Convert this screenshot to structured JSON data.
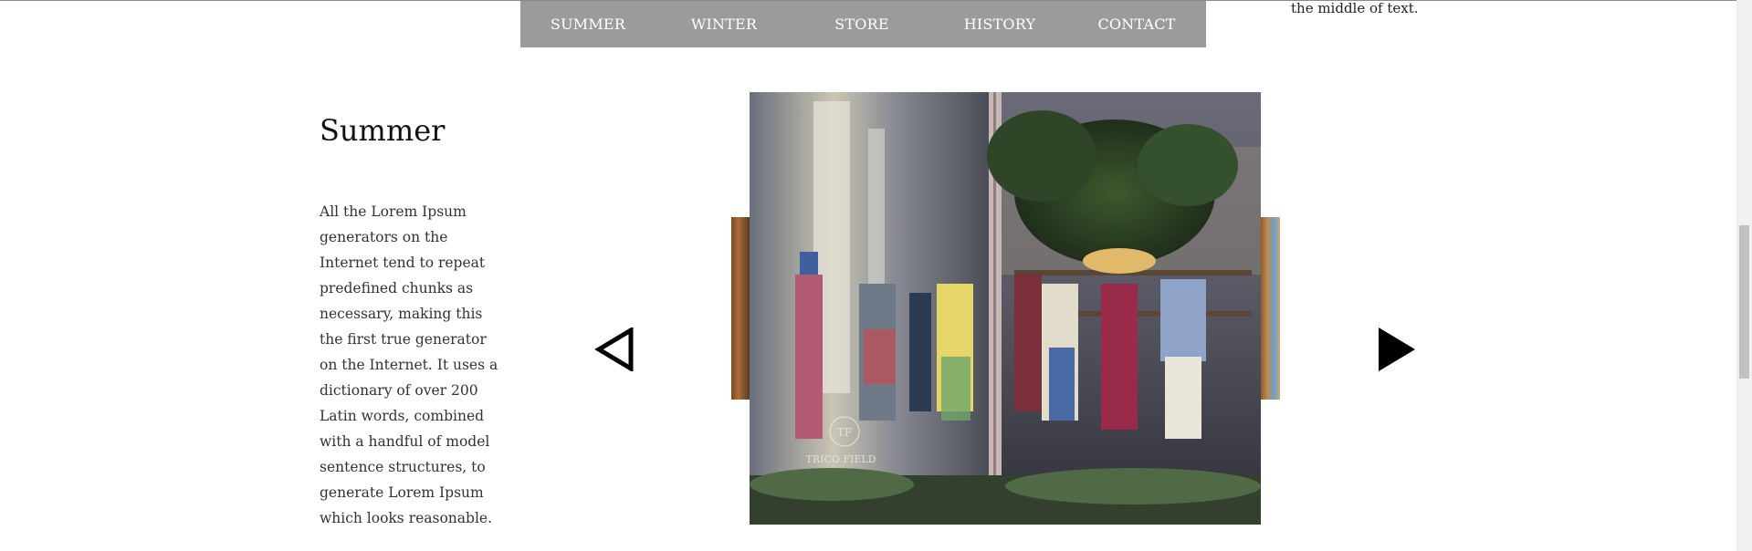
{
  "nav": {
    "items": [
      {
        "label": "SUMMER"
      },
      {
        "label": "WINTER"
      },
      {
        "label": "STORE"
      },
      {
        "label": "HISTORY"
      },
      {
        "label": "CONTACT"
      }
    ],
    "background": "#9b9b9b",
    "text_color": "#ffffff"
  },
  "top_right_text": "the middle of text.",
  "section": {
    "title": "Summer",
    "body": "All the Lorem Ipsum generators on the Internet tend to repeat predefined chunks as necessary, making this the first true generator on the Internet. It uses a dictionary of over 200 Latin words, combined with a handful of model sentence structures, to generate Lorem Ipsum which looks reasonable."
  },
  "carousel": {
    "prev_icon": "triangle-left-outline-icon",
    "next_icon": "triangle-right-filled-icon",
    "slide_logo": {
      "monogram": "TF",
      "brand": "TRICO FIELD"
    }
  }
}
